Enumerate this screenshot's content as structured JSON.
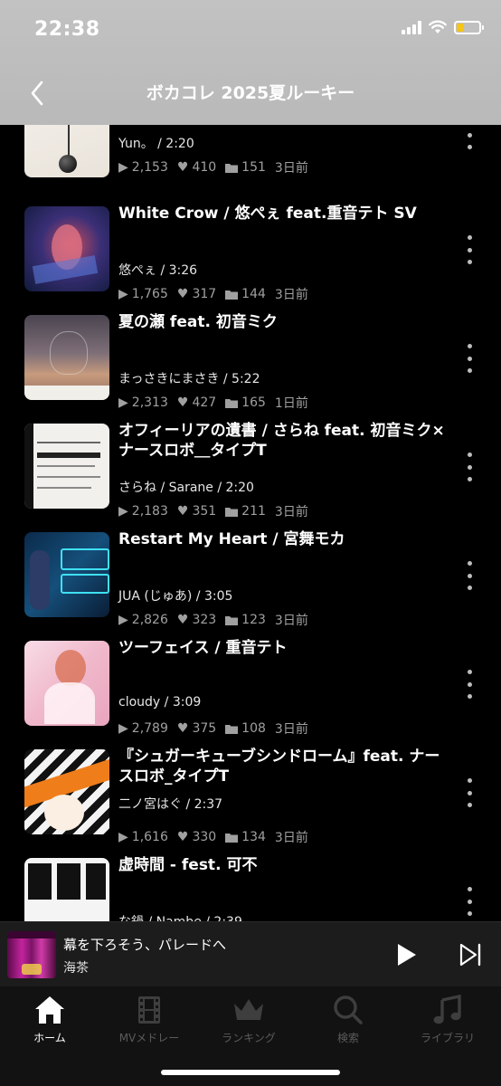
{
  "status_bar": {
    "time": "22:38"
  },
  "header": {
    "title": "ボカコレ 2025夏ルーキー"
  },
  "tracks": [
    {
      "title": "",
      "artist": "Yun。 / 2:20",
      "plays": "2,153",
      "likes": "410",
      "mylist": "151",
      "ago": "3日前"
    },
    {
      "title": "White Crow / 悠ぺぇ feat.重音テト SV",
      "artist": "悠ぺぇ / 3:26",
      "plays": "1,765",
      "likes": "317",
      "mylist": "144",
      "ago": "3日前"
    },
    {
      "title": "夏の瀬 feat. 初音ミク",
      "artist": "まっさきにまさき / 5:22",
      "plays": "2,313",
      "likes": "427",
      "mylist": "165",
      "ago": "1日前"
    },
    {
      "title": "オフィーリアの遺書 / さらね feat. 初音ミク×ナースロボ＿タイプT",
      "artist": "さらね / Sarane / 2:20",
      "plays": "2,183",
      "likes": "351",
      "mylist": "211",
      "ago": "3日前"
    },
    {
      "title": "Restart My Heart / 宮舞モカ",
      "artist": "JUA (じゅあ) / 3:05",
      "plays": "2,826",
      "likes": "323",
      "mylist": "123",
      "ago": "3日前"
    },
    {
      "title": "ツーフェイス / 重音テト",
      "artist": "cloudy / 3:09",
      "plays": "2,789",
      "likes": "375",
      "mylist": "108",
      "ago": "3日前"
    },
    {
      "title": "『シュガーキューブシンドローム』feat. ナースロボ_タイプT",
      "artist": "二ノ宮はぐ / 2:37",
      "plays": "1,616",
      "likes": "330",
      "mylist": "134",
      "ago": "3日前"
    },
    {
      "title": "虚時間 - fest. 可不",
      "artist": "な鍋 / Nambe / 2:39",
      "plays": "",
      "likes": "",
      "mylist": "",
      "ago": ""
    }
  ],
  "now_playing": {
    "title": "幕を下ろそう、パレードへ",
    "artist": "海茶"
  },
  "tabs": [
    {
      "label": "ホーム",
      "icon": "home-icon",
      "active": true
    },
    {
      "label": "MVメドレー",
      "icon": "film-icon",
      "active": false
    },
    {
      "label": "ランキング",
      "icon": "crown-icon",
      "active": false
    },
    {
      "label": "検索",
      "icon": "search-icon",
      "active": false
    },
    {
      "label": "ライブラリ",
      "icon": "music-note-icon",
      "active": false
    }
  ],
  "colors": {
    "header_bg": "#bdbdbd",
    "battery": "#f5c518",
    "inactive_tab": "#5b5b5b"
  }
}
